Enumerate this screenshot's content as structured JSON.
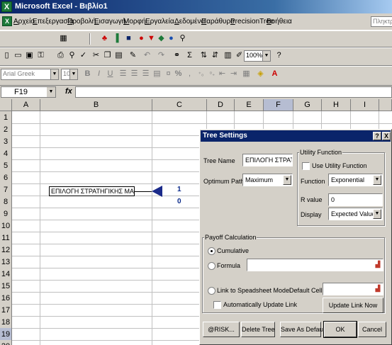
{
  "window": {
    "title": "Microsoft Excel - Βιβλίο1",
    "app_icon": "X"
  },
  "menubar": {
    "items": [
      "Αρχείο",
      "Επεξεργασία",
      "Προβολή",
      "Εισαγωγή",
      "Μορφή",
      "Εργαλεία",
      "Δεδομένα",
      "Παράθυρο",
      "PrecisionTree",
      "Βοήθεια"
    ],
    "help_placeholder": "Πληκτρολογήστε"
  },
  "standard_toolbar": {
    "zoom": "100%"
  },
  "formatting_toolbar": {
    "font": "Arial Greek",
    "size": "10",
    "bold": "B",
    "italic": "I",
    "underline": "U",
    "percent": "%"
  },
  "formula_bar": {
    "name_box": "F19",
    "fx": "fx",
    "value": ""
  },
  "grid": {
    "columns": [
      "A",
      "B",
      "C",
      "D",
      "E",
      "F",
      "G",
      "H",
      "I"
    ],
    "active_column": "F",
    "rows": [
      "1",
      "2",
      "3",
      "4",
      "5",
      "6",
      "7",
      "8",
      "9",
      "10",
      "11",
      "12",
      "13",
      "14",
      "15",
      "16",
      "17",
      "18",
      "19",
      "20"
    ],
    "active_row": "19"
  },
  "tree": {
    "node_label": "ΕΠΙΛΟΓΗ ΣΤΡΑΤΗΓΙΚΗΣ ΜΑΡΚΕΤΙΝΓΚ",
    "value_top": "1",
    "value_bottom": "0",
    "node_color": "#1a2a8a"
  },
  "dialog": {
    "title": "Tree Settings",
    "help_btn": "?",
    "close_btn": "X",
    "tree_name_label": "Tree Name",
    "tree_name_value": "ΕΠΙΛΟΓΗ ΣΤΡΑΤΗΓΙΚΗΣ",
    "optimum_path_label": "Optimum Path",
    "optimum_path_value": "Maximum",
    "utility_group_label": "Utility Function",
    "use_utility_label": "Use Utility Function",
    "function_label": "Function",
    "function_value": "Exponential",
    "r_value_label": "R value",
    "r_value": "0",
    "display_label": "Display",
    "display_value": "Expected Value",
    "payoff_group_label": "Payoff Calculation",
    "cumulative_label": "Cumulative",
    "formula_label": "Formula",
    "link_label": "Link to Speadsheet Model",
    "default_cell_label": "Default Cell",
    "auto_update_label": "Automatically Update Link",
    "update_link_btn": "Update Link Now",
    "buttons": {
      "risk": "@RISK...",
      "delete": "Delete Tree",
      "save_default": "Save As Default",
      "ok": "OK",
      "cancel": "Cancel"
    }
  }
}
